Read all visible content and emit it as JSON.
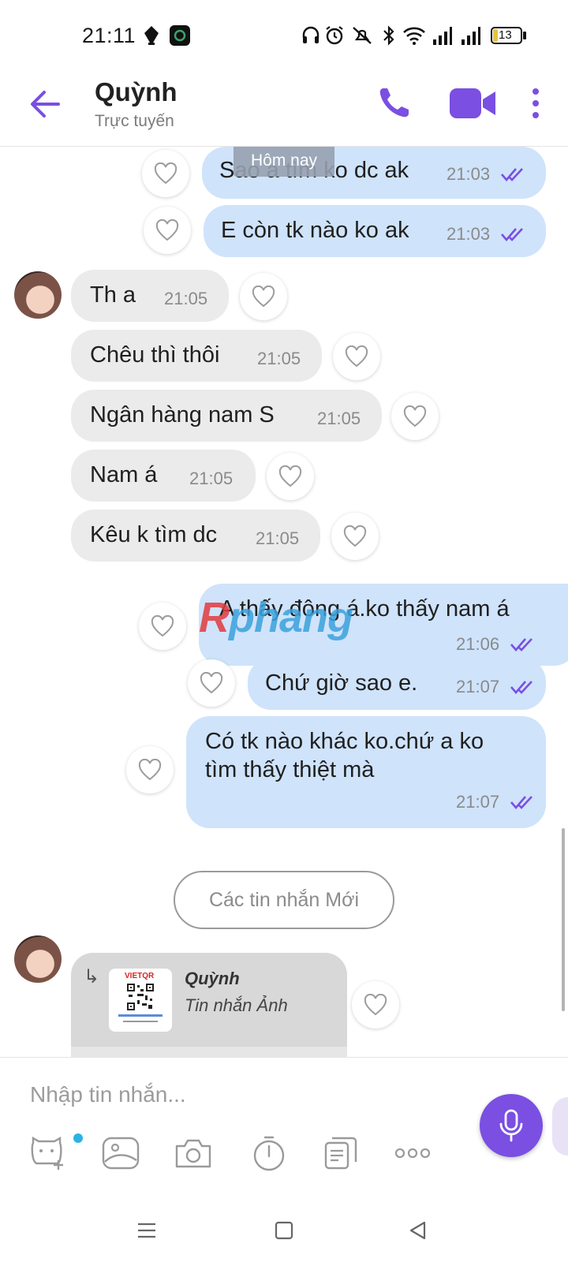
{
  "status_bar": {
    "time": "21:11",
    "battery": "13",
    "icons": [
      "pen-icon",
      "app-icon",
      "headphones-icon",
      "alarm-icon",
      "mute-icon",
      "bluetooth-icon",
      "wifi-icon",
      "signal-icon",
      "signal-icon",
      "battery-icon"
    ]
  },
  "header": {
    "name": "Quỳnh",
    "status": "Trực tuyến",
    "accent": "#7a4fe2"
  },
  "chat": {
    "date_separator": "Hôm nay",
    "messages": [
      {
        "dir": "out",
        "text": "Sao a tìm ko dc ak",
        "time": "21:03"
      },
      {
        "dir": "out",
        "text": "E còn tk nào ko ak",
        "time": "21:03"
      },
      {
        "dir": "in",
        "text": "Th a",
        "time": "21:05"
      },
      {
        "dir": "in",
        "text": "Chêu thì thôi",
        "time": "21:05"
      },
      {
        "dir": "in",
        "text": "Ngân hàng nam S",
        "time": "21:05"
      },
      {
        "dir": "in",
        "text": "Nam á",
        "time": "21:05"
      },
      {
        "dir": "in",
        "text": "Kêu k tìm dc",
        "time": "21:05"
      },
      {
        "dir": "out",
        "text": "A thấy đông á.ko thấy nam á",
        "time": "21:06"
      },
      {
        "dir": "out",
        "text": "Chứ giờ sao e.",
        "time": "21:07"
      },
      {
        "dir": "out",
        "text_line1": "Có tk nào khác ko.chứ a ko",
        "text_line2": "tìm thấy thiệt mà",
        "time": "21:07"
      }
    ],
    "new_messages_label": "Các tin nhắn Mới",
    "reply": {
      "sender": "Quỳnh",
      "type": "Tin nhắn Ảnh",
      "thumb_brand": "VIETQR"
    },
    "outgoing_color": "#cfe3fb",
    "incoming_color": "#ebebeb"
  },
  "watermark": {
    "first": "R",
    "rest": "phang"
  },
  "composer": {
    "placeholder": "Nhập tin nhắn...",
    "tools": [
      "sticker-icon",
      "gallery-icon",
      "camera-icon",
      "timer-icon",
      "documents-icon",
      "more-icon"
    ]
  },
  "nav_bar": {
    "buttons": [
      "menu-icon",
      "home-icon",
      "back-icon"
    ]
  }
}
